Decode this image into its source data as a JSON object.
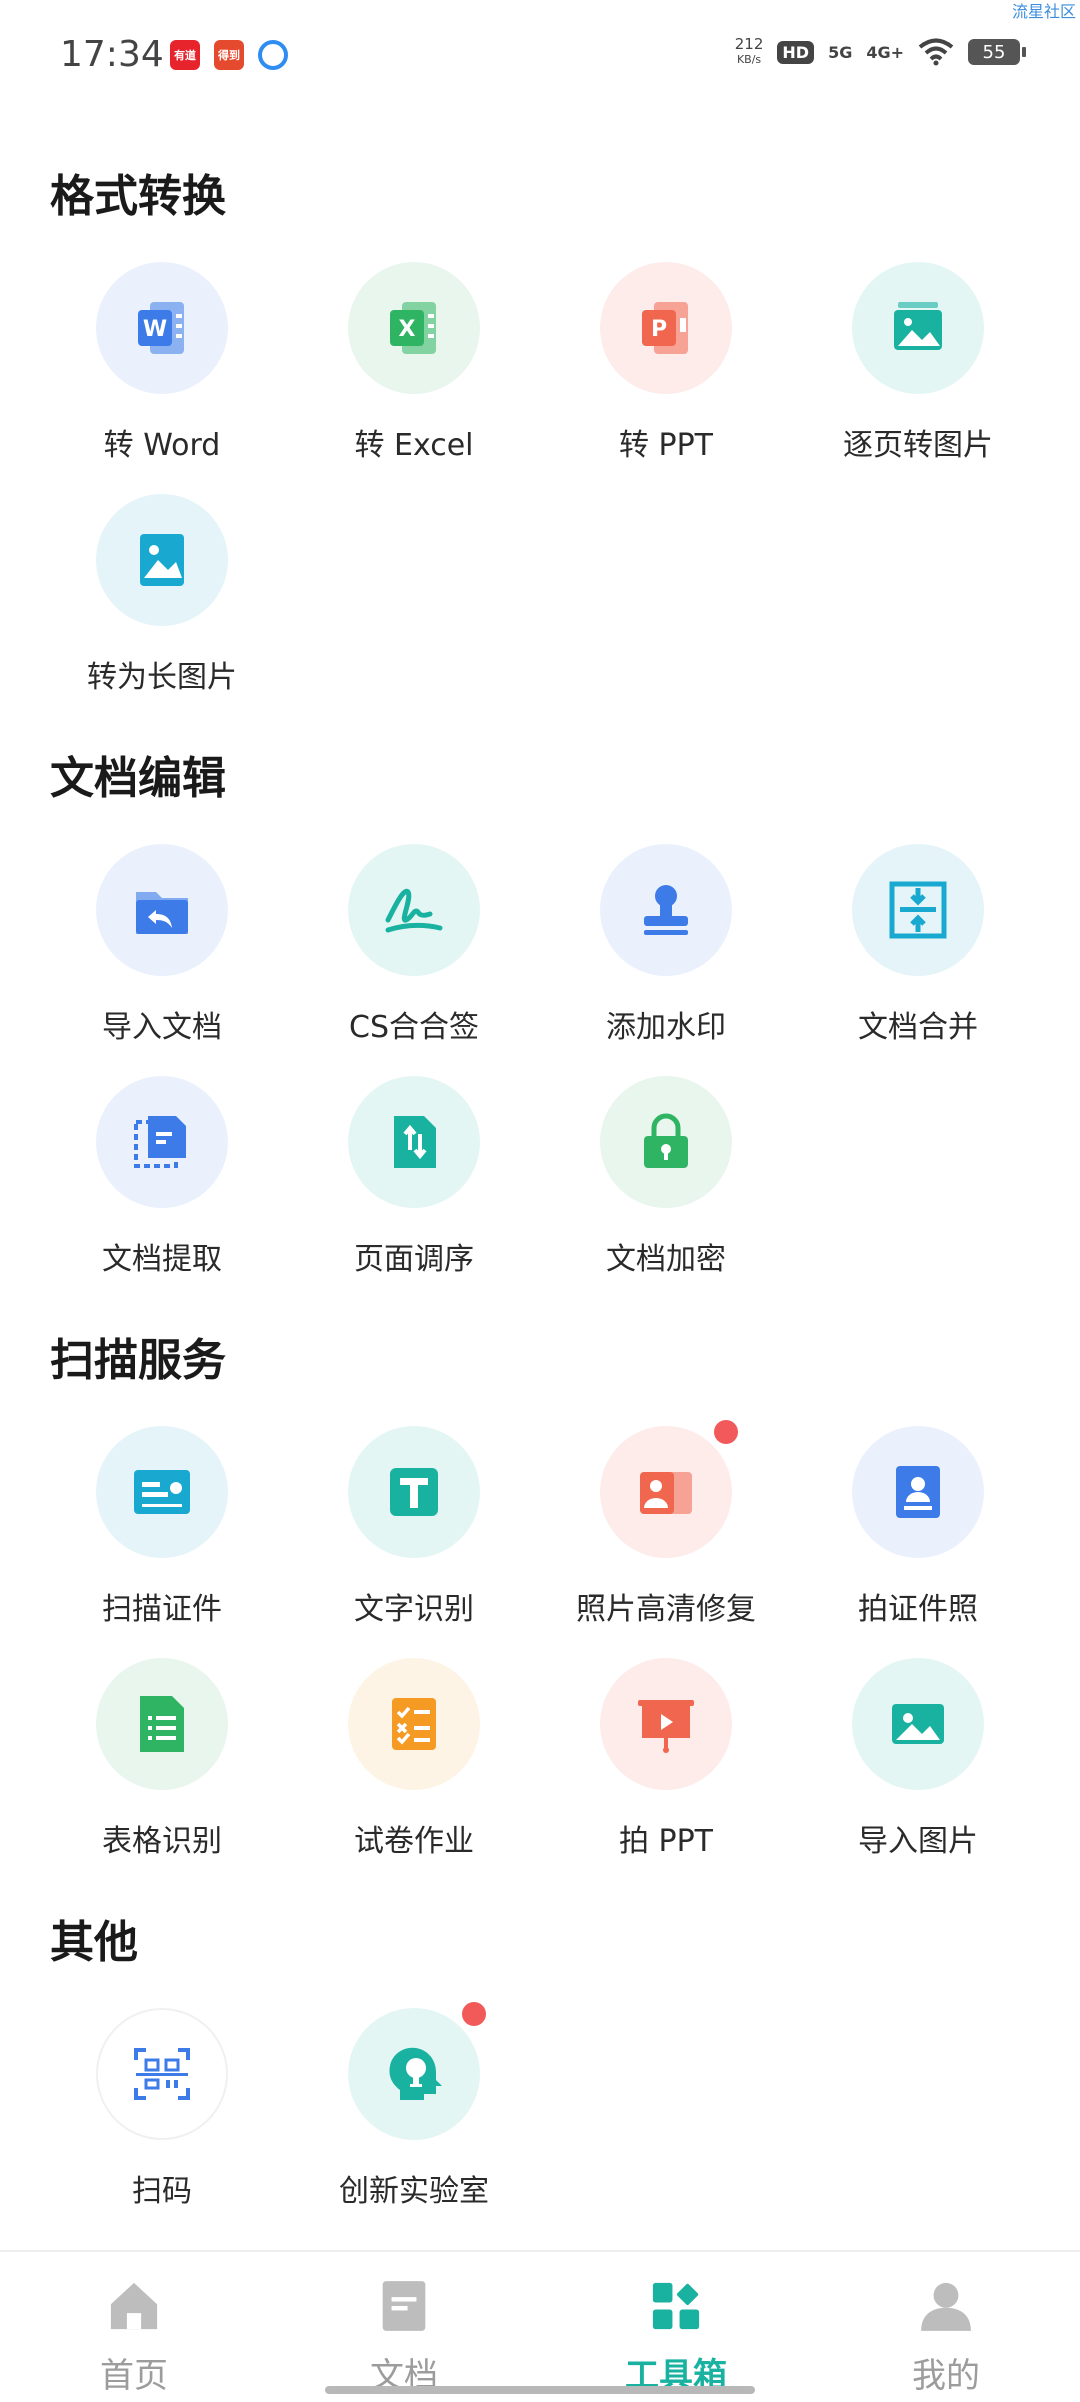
{
  "status": {
    "time": "17:34",
    "apps": [
      {
        "name": "app-1",
        "text": "有道",
        "color": "#e7242c"
      },
      {
        "name": "app-2",
        "text": "得到",
        "color": "#e64a2e"
      },
      {
        "name": "app-3",
        "text": "",
        "color": "#2f8cf0"
      }
    ],
    "speed_value": "212",
    "speed_unit": "KB/s",
    "hd": "HD",
    "net1": "5G",
    "net2": "4G+",
    "battery": "55",
    "watermark": "流星社区"
  },
  "sections": [
    {
      "title": "格式转换",
      "tools": [
        {
          "label": "转 Word",
          "icon": "word-icon",
          "bg": "#eaf1fd",
          "fg": "#3c7be8"
        },
        {
          "label": "转 Excel",
          "icon": "excel-icon",
          "bg": "#e8f6ee",
          "fg": "#2fb463"
        },
        {
          "label": "转 PPT",
          "icon": "ppt-icon",
          "bg": "#fdecea",
          "fg": "#f0664e"
        },
        {
          "label": "逐页转图片",
          "icon": "page-image-icon",
          "bg": "#e3f6f4",
          "fg": "#19b2a1"
        },
        {
          "label": "转为长图片",
          "icon": "long-image-icon",
          "bg": "#e4f4f9",
          "fg": "#19a8cf"
        }
      ]
    },
    {
      "title": "文档编辑",
      "tools": [
        {
          "label": "导入文档",
          "icon": "folder-import-icon",
          "bg": "#eaf1fd",
          "fg": "#3c7be8"
        },
        {
          "label": "CS合合签",
          "icon": "signature-icon",
          "bg": "#e3f6f4",
          "fg": "#19b2a1"
        },
        {
          "label": "添加水印",
          "icon": "stamp-icon",
          "bg": "#eaf1fd",
          "fg": "#3c7be8"
        },
        {
          "label": "文档合并",
          "icon": "merge-icon",
          "bg": "#e4f4f9",
          "fg": "#19a8cf"
        },
        {
          "label": "文档提取",
          "icon": "extract-icon",
          "bg": "#eaf1fd",
          "fg": "#3c7be8"
        },
        {
          "label": "页面调序",
          "icon": "reorder-icon",
          "bg": "#e3f6f4",
          "fg": "#19b2a1"
        },
        {
          "label": "文档加密",
          "icon": "lock-icon",
          "bg": "#e8f6ee",
          "fg": "#2fb463"
        }
      ]
    },
    {
      "title": "扫描服务",
      "tools": [
        {
          "label": "扫描证件",
          "icon": "id-card-icon",
          "bg": "#e4f4f9",
          "fg": "#19a8cf"
        },
        {
          "label": "文字识别",
          "icon": "text-t-icon",
          "bg": "#e3f6f4",
          "fg": "#19b2a1"
        },
        {
          "label": "照片高清修复",
          "icon": "photo-restore-icon",
          "bg": "#fdecea",
          "fg": "#f0664e",
          "dot": true
        },
        {
          "label": "拍证件照",
          "icon": "id-photo-icon",
          "bg": "#eaf1fd",
          "fg": "#3c7be8"
        },
        {
          "label": "表格识别",
          "icon": "table-sheet-icon",
          "bg": "#e8f6ee",
          "fg": "#2fb463"
        },
        {
          "label": "试卷作业",
          "icon": "exam-paper-icon",
          "bg": "#fdf4e6",
          "fg": "#f59a23"
        },
        {
          "label": "拍 PPT",
          "icon": "presentation-icon",
          "bg": "#fdecea",
          "fg": "#f0664e"
        },
        {
          "label": "导入图片",
          "icon": "image-import-icon",
          "bg": "#e3f6f4",
          "fg": "#19b2a1"
        }
      ]
    },
    {
      "title": "其他",
      "tools": [
        {
          "label": "扫码",
          "icon": "qr-scan-icon",
          "bg": "#ffffff",
          "fg": "#3c7be8",
          "border": true
        },
        {
          "label": "创新实验室",
          "icon": "lab-bulb-icon",
          "bg": "#e3f6f4",
          "fg": "#19b2a1",
          "dot": true
        }
      ]
    }
  ],
  "tabs": [
    {
      "label": "首页",
      "icon": "home-icon",
      "active": false
    },
    {
      "label": "文档",
      "icon": "document-icon",
      "active": false
    },
    {
      "label": "工具箱",
      "icon": "toolbox-icon",
      "active": true
    },
    {
      "label": "我的",
      "icon": "profile-icon",
      "active": false
    }
  ],
  "colors": {
    "accent": "#19b2a1",
    "inactive": "#bdbdbd"
  }
}
